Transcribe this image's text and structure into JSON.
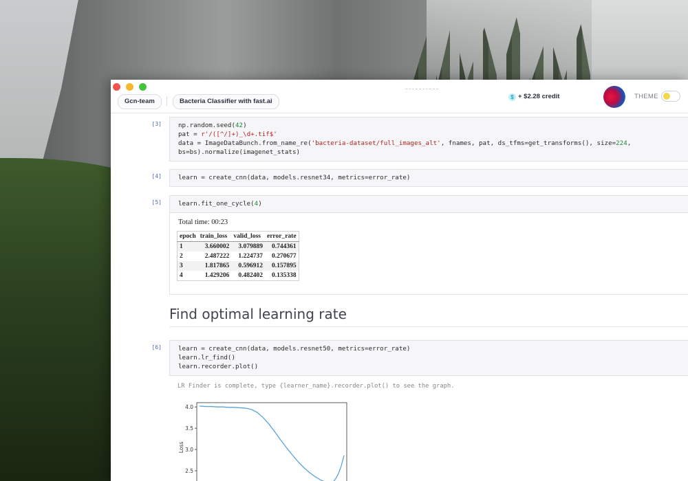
{
  "window": {
    "team_label": "Gcn-team",
    "project_label": "Bacteria Classifier with fast.ai",
    "credit_icon": "$",
    "credit_text": "+ $2.28  credit",
    "theme_label": "THEME"
  },
  "cells": [
    {
      "prompt": "[3]",
      "lines": [
        [
          {
            "t": "np.random.seed("
          },
          {
            "t": "42",
            "c": "num"
          },
          {
            "t": ")"
          }
        ],
        [
          {
            "t": "pat = "
          },
          {
            "t": "r'/([^/]+)_\\d+.tif$'",
            "c": "str"
          }
        ],
        [
          {
            "t": "data = ImageDataBunch.from_name_re("
          },
          {
            "t": "'bacteria-dataset/full_images_alt'",
            "c": "str"
          },
          {
            "t": ", fnames, pat, ds_tfms=get_transforms(), size="
          },
          {
            "t": "224",
            "c": "num"
          },
          {
            "t": ","
          }
        ],
        [
          {
            "t": "bs=bs).normalize(imagenet_stats)"
          }
        ]
      ]
    },
    {
      "prompt": "[4]",
      "lines": [
        [
          {
            "t": "learn = create_cnn(data, models.resnet34, metrics=error_rate)"
          }
        ]
      ]
    },
    {
      "prompt": "[5]",
      "lines": [
        [
          {
            "t": "learn.fit_one_cycle("
          },
          {
            "t": "4",
            "c": "num"
          },
          {
            "t": ")"
          }
        ]
      ]
    },
    {
      "prompt": "[6]",
      "lines": [
        [
          {
            "t": "learn = create_cnn(data, models.resnet50, metrics=error_rate)"
          }
        ],
        [
          {
            "t": "learn.lr_find()"
          }
        ],
        [
          {
            "t": "learn.recorder.plot()"
          }
        ]
      ]
    }
  ],
  "training_output": {
    "total_time": "Total time: 00:23",
    "headers": [
      "epoch",
      "train_loss",
      "valid_loss",
      "error_rate"
    ],
    "rows": [
      [
        "1",
        "3.660002",
        "3.079889",
        "0.744361"
      ],
      [
        "2",
        "2.487222",
        "1.224737",
        "0.270677"
      ],
      [
        "3",
        "1.817865",
        "0.596912",
        "0.157895"
      ],
      [
        "4",
        "1.429206",
        "0.482402",
        "0.135338"
      ]
    ]
  },
  "markdown": {
    "heading": "Find optimal learning rate"
  },
  "lr_finder": {
    "message": "LR Finder is complete, type {learner_name}.recorder.plot() to see the graph."
  },
  "chart_data": {
    "type": "line",
    "title": "",
    "xlabel": "",
    "ylabel": "Loss",
    "ylim": [
      2.0,
      4.1
    ],
    "yticks": [
      "4.0",
      "3.5",
      "3.0",
      "2.5"
    ],
    "series": [
      {
        "color": "#5aa3d6",
        "x": [
          0,
          0.04,
          0.08,
          0.12,
          0.16,
          0.2,
          0.24,
          0.28,
          0.32,
          0.36,
          0.4,
          0.44,
          0.48,
          0.52,
          0.56,
          0.6,
          0.64,
          0.68,
          0.72,
          0.76,
          0.8,
          0.84,
          0.88,
          0.9,
          0.92,
          0.94,
          0.96,
          0.98,
          1.0
        ],
        "y": [
          4.02,
          4.01,
          4.01,
          4.0,
          4.0,
          3.99,
          3.99,
          3.98,
          3.97,
          3.94,
          3.87,
          3.75,
          3.6,
          3.42,
          3.23,
          3.05,
          2.88,
          2.72,
          2.58,
          2.46,
          2.36,
          2.28,
          2.22,
          2.2,
          2.22,
          2.3,
          2.42,
          2.6,
          2.86
        ]
      }
    ]
  }
}
